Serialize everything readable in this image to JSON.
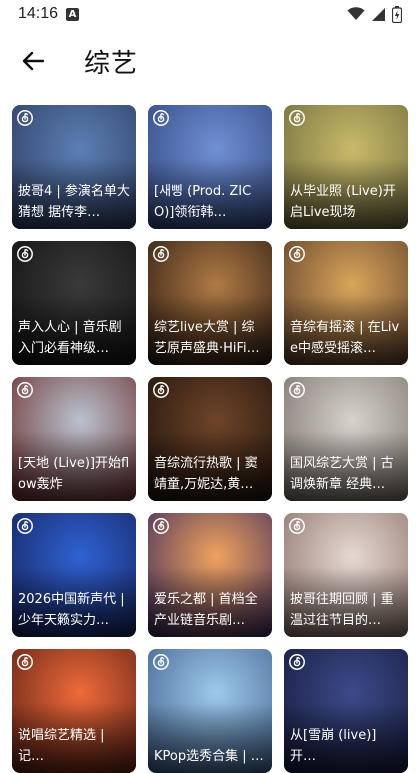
{
  "status": {
    "time": "14:16",
    "notification_badge": "A"
  },
  "header": {
    "title": "综艺"
  },
  "cards": [
    {
      "title": "披哥4 | 参演名单大猜想 据传李…",
      "bg": [
        "#5b7fb4",
        "#2d3b60"
      ]
    },
    {
      "title": "[새삥 (Prod. ZICO)]领衔韩…",
      "bg": [
        "#6f90d4",
        "#31457e"
      ]
    },
    {
      "title": "从毕业照 (Live)开启Live现场",
      "bg": [
        "#c9ba6a",
        "#6d6a3c"
      ]
    },
    {
      "title": "声入人心 | 音乐剧入门必看神级…",
      "bg": [
        "#3a3a3a",
        "#111111"
      ]
    },
    {
      "title": "综艺live大赏 | 综艺原声盛典·HiFi…",
      "bg": [
        "#b07a45",
        "#2a1a12"
      ]
    },
    {
      "title": "音综有摇滚 | 在Live中感受摇滚…",
      "bg": [
        "#d8a55a",
        "#5c3d2a"
      ]
    },
    {
      "title": "[天地 (Live)]开始flow轰炸",
      "bg": [
        "#b9c3cf",
        "#6b2b2b"
      ]
    },
    {
      "title": "音综流行热歌 | 窦靖童,万妮达,黄…",
      "bg": [
        "#6e4428",
        "#1e120c"
      ]
    },
    {
      "title": "国风综艺大赏 | 古调焕新章 经典…",
      "bg": [
        "#d6d2cc",
        "#7a6f68"
      ]
    },
    {
      "title": "2026中国新声代 | 少年天籁实力…",
      "bg": [
        "#2f62d3",
        "#15215a"
      ]
    },
    {
      "title": "爱乐之都 | 首档全产业链音乐剧…",
      "bg": [
        "#f0a25e",
        "#3d2a5c"
      ]
    },
    {
      "title": "披哥往期回顾 | 重温过往节目的…",
      "bg": [
        "#e6d9d4",
        "#8a6f66"
      ]
    },
    {
      "title": "说唱综艺精选 | 记…",
      "bg": [
        "#ef6a3a",
        "#5a1f14"
      ]
    },
    {
      "title": "KPop选秀合集 | …",
      "bg": [
        "#9ec9ec",
        "#3f5f8c"
      ]
    },
    {
      "title": "从[雪崩 (live)]开…",
      "bg": [
        "#3c4a8a",
        "#151a3a"
      ]
    }
  ],
  "icons": {
    "back": "arrow-left-icon",
    "card_badge": "netease-music-icon",
    "wifi": "wifi-icon",
    "signal": "signal-icon",
    "battery": "battery-icon"
  }
}
